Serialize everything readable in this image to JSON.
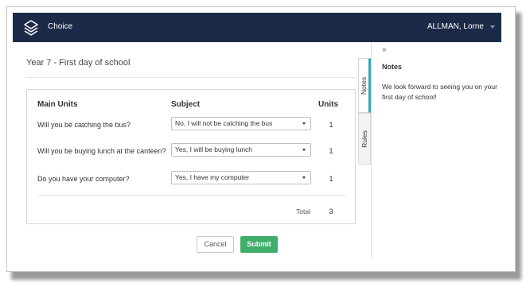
{
  "app": {
    "title": "Choice",
    "user": "ALLMAN, Lorne"
  },
  "page": {
    "title": "Year 7 - First day of school"
  },
  "table": {
    "headers": {
      "units_col": "Main Units",
      "subject_col": "Subject",
      "count_col": "Units"
    },
    "rows": [
      {
        "question": "Will you be catching the bus?",
        "answer": "No, I will not be catching the bus",
        "units": "1"
      },
      {
        "question": "Will you be buying lunch at the canteen?",
        "answer": "Yes, I will be buying lunch",
        "units": "1"
      },
      {
        "question": "Do you have your computer?",
        "answer": "Yes, I have my computer",
        "units": "1"
      }
    ],
    "total_label": "Total",
    "total_value": "3"
  },
  "buttons": {
    "cancel": "Cancel",
    "submit": "Submit"
  },
  "side_tabs": {
    "notes": "Notes",
    "rules": "Rules",
    "active": "notes"
  },
  "notes_panel": {
    "collapse_glyph": "»",
    "title": "Notes",
    "body": "We look forward to seeing you on your first day of school!"
  },
  "colors": {
    "header_bg": "#1b2a47",
    "submit_bg": "#3fae6a",
    "active_tab_accent": "#34a7b8"
  },
  "icons": {
    "logo": "layers-logo-icon",
    "user_menu": "caret-down-icon",
    "select": "select-caret-icon",
    "collapse": "double-chevron-right-icon"
  }
}
